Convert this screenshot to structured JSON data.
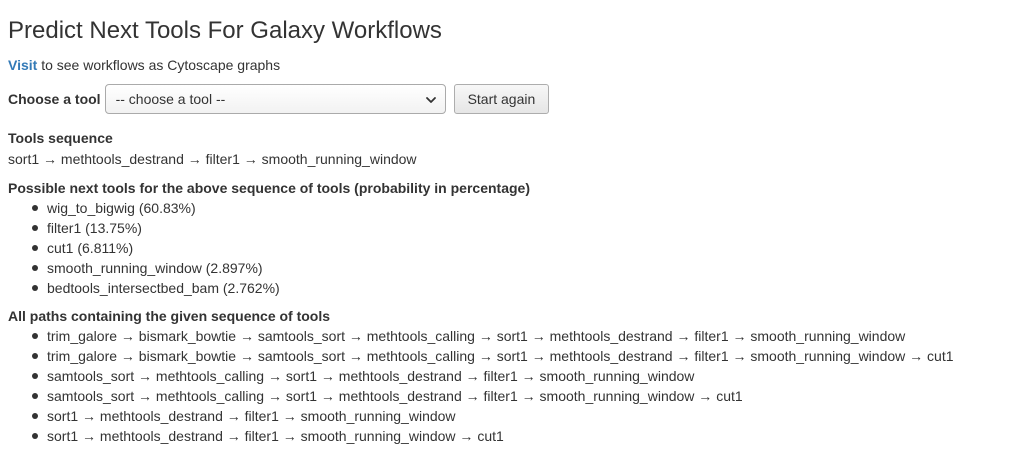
{
  "title": "Predict Next Tools For Galaxy Workflows",
  "visit": {
    "link_text": "Visit",
    "rest_text": " to see workflows as Cytoscape graphs"
  },
  "chooser": {
    "label": "Choose a tool",
    "selected": "-- choose a tool --",
    "start_again_label": "Start again"
  },
  "sequence": {
    "heading": "Tools sequence",
    "text": "sort1 → methtools_destrand → filter1 → smooth_running_window"
  },
  "next_tools": {
    "heading": "Possible next tools for the above sequence of tools (probability in percentage)",
    "items": [
      "wig_to_bigwig (60.83%)",
      "filter1 (13.75%)",
      "cut1 (6.811%)",
      "smooth_running_window (2.897%)",
      "bedtools_intersectbed_bam (2.762%)"
    ]
  },
  "paths": {
    "heading": "All paths containing the given sequence of tools",
    "items": [
      "trim_galore → bismark_bowtie → samtools_sort → methtools_calling → sort1 → methtools_destrand → filter1 → smooth_running_window",
      "trim_galore → bismark_bowtie → samtools_sort → methtools_calling → sort1 → methtools_destrand → filter1 → smooth_running_window → cut1",
      "samtools_sort → methtools_calling → sort1 → methtools_destrand → filter1 → smooth_running_window",
      "samtools_sort → methtools_calling → sort1 → methtools_destrand → filter1 → smooth_running_window → cut1",
      "sort1 → methtools_destrand → filter1 → smooth_running_window",
      "sort1 → methtools_destrand → filter1 → smooth_running_window → cut1"
    ]
  }
}
